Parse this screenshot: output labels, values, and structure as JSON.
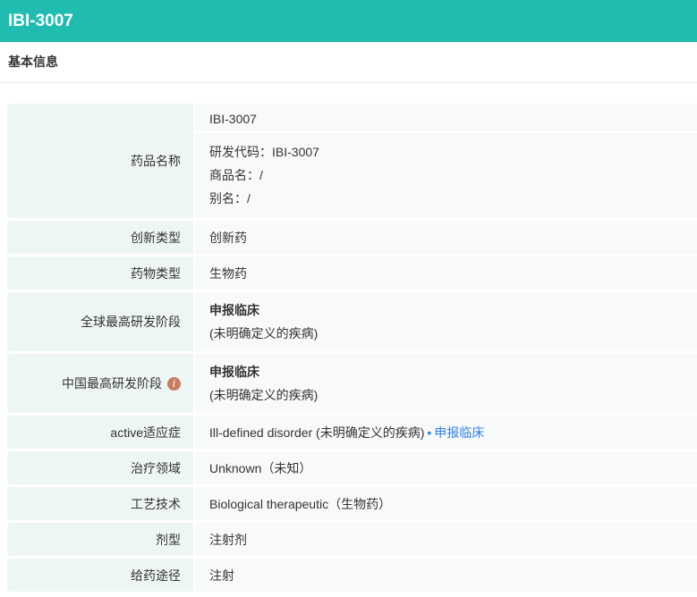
{
  "title": "IBI-3007",
  "section": "基本信息",
  "name_label": "药品名称",
  "name_main": "IBI-3007",
  "name_lines": [
    "研发代码：IBI-3007",
    "商品名：/",
    "别名：/"
  ],
  "rows": [
    {
      "label": "创新类型",
      "value": "创新药"
    },
    {
      "label": "药物类型",
      "value": "生物药"
    },
    {
      "label": "全球最高研发阶段",
      "value": "申报临床",
      "sub": "(未明确定义的疾病)"
    },
    {
      "label": "中国最高研发阶段",
      "value": "申报临床",
      "sub": "(未明确定义的疾病)",
      "icon": "i"
    },
    {
      "label": "active适应症",
      "value": "Ill-defined disorder (未明确定义的疾病)",
      "link": "申报临床"
    },
    {
      "label": "治疗领域",
      "value": "Unknown（未知）"
    },
    {
      "label": "工艺技术",
      "value": "Biological therapeutic（生物药）"
    },
    {
      "label": "剂型",
      "value": "注射剂"
    },
    {
      "label": "给药途径",
      "value": "注射"
    }
  ],
  "colors": {
    "header": "#20bcb0",
    "link": "#2f80ed",
    "info": "#c97c5d"
  }
}
